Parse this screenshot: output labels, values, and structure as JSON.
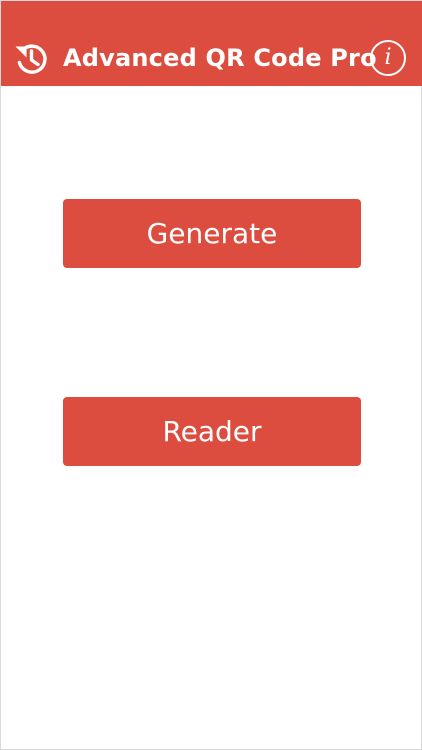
{
  "header": {
    "title": "Advanced QR Code Pro",
    "history_icon": "history-icon",
    "info_icon": "info-icon",
    "info_glyph": "i"
  },
  "main": {
    "generate_label": "Generate",
    "reader_label": "Reader"
  },
  "colors": {
    "accent": "#dc4d3f",
    "background": "#ffffff",
    "text_on_accent": "#ffffff"
  }
}
